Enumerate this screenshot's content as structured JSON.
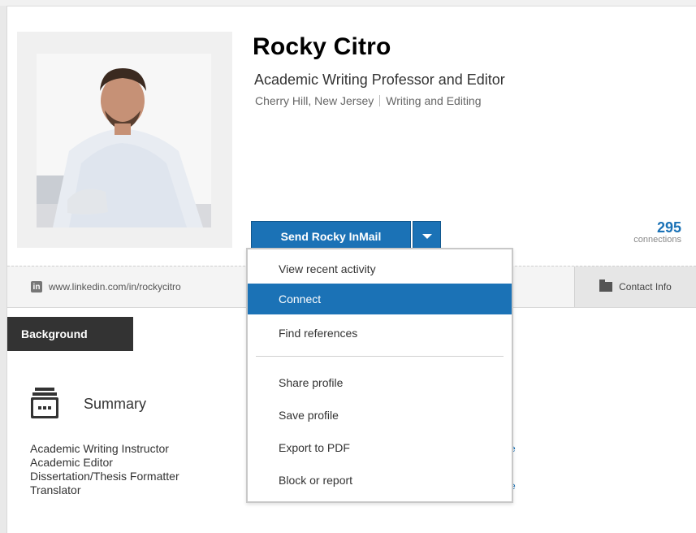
{
  "profile": {
    "name": "Rocky Citro",
    "headline": "Academic Writing Professor and Editor",
    "location": "Cherry Hill, New Jersey",
    "industry": "Writing and Editing",
    "public_url": "www.linkedin.com/in/rockycitro",
    "connections_count": "295",
    "connections_label": "connections"
  },
  "actions": {
    "inmail_label": "Send Rocky InMail",
    "contact_info_label": "Contact Info"
  },
  "dropdown_menu": {
    "items": [
      {
        "label": "View recent activity",
        "active": false
      },
      {
        "label": "Connect",
        "active": true
      },
      {
        "label": "Find references",
        "active": false
      },
      {
        "label": "Share profile",
        "active": false
      },
      {
        "label": "Save profile",
        "active": false
      },
      {
        "label": "Export to PDF",
        "active": false
      },
      {
        "label": "Block or report",
        "active": false
      }
    ]
  },
  "background": {
    "tab_label": "Background",
    "summary_title": "Summary",
    "summary_lines": [
      "Academic Writing Instructor",
      "Academic Editor",
      "Dissertation/Thesis Formatter",
      "Translator"
    ]
  },
  "icons": {
    "linkedin": "linkedin-icon",
    "caret": "chevron-down-icon",
    "contact": "contact-card-icon",
    "summary": "summary-folder-icon"
  },
  "colors": {
    "accent": "#1b72b6",
    "dark_tab": "#333333"
  }
}
